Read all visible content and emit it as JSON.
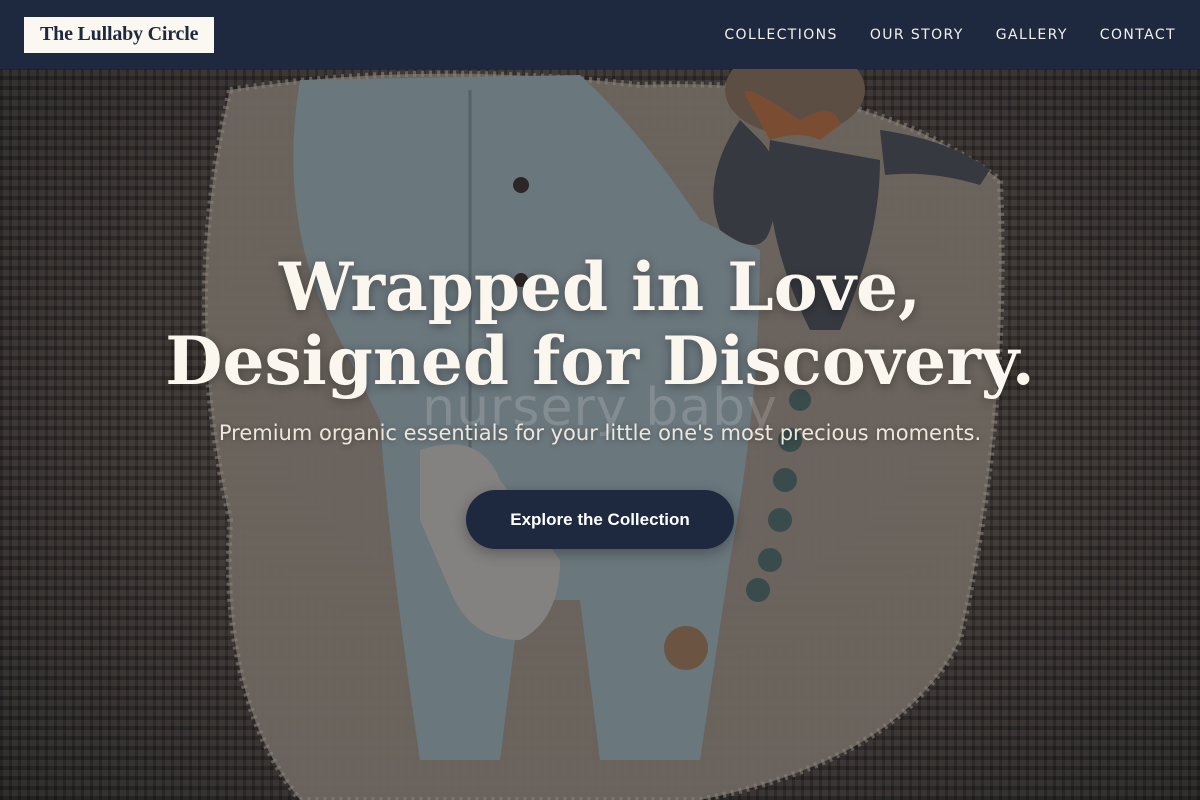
{
  "header": {
    "logo_text": "The Lullaby Circle",
    "nav": [
      {
        "label": "COLLECTIONS"
      },
      {
        "label": "OUR STORY"
      },
      {
        "label": "GALLERY"
      },
      {
        "label": "CONTACT"
      }
    ]
  },
  "hero": {
    "title_line_1": "Wrapped in Love,",
    "title_line_2": "Designed for Discovery.",
    "watermark": "nursery baby",
    "subtitle": "Premium organic essentials for your little one's most precious moments.",
    "cta_label": "Explore the Collection"
  },
  "colors": {
    "navy": "#1e293f",
    "cream": "#fbf8f1"
  }
}
